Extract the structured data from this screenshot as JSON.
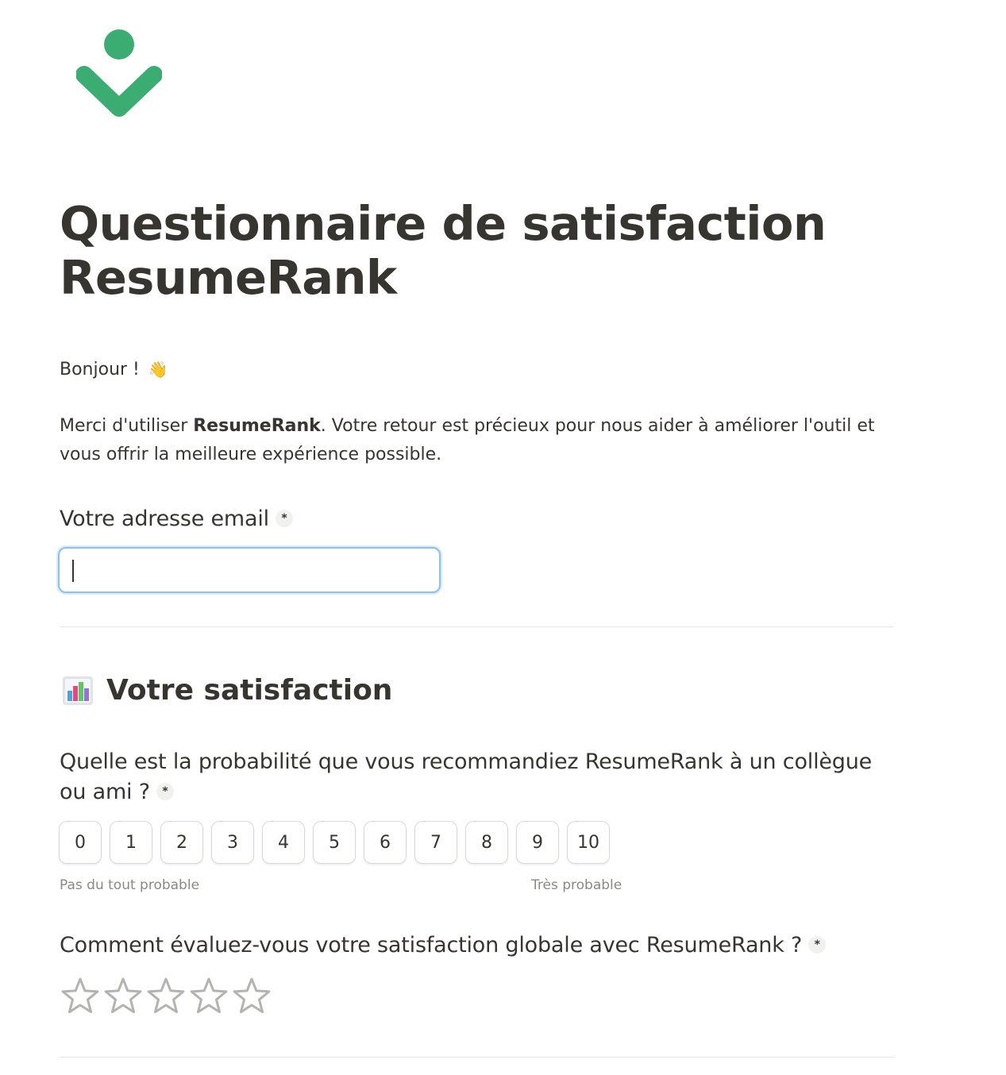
{
  "brand": {
    "logo_icon": "resumerank-checkmark-logo",
    "accent_color": "#3cad72"
  },
  "form": {
    "title": "Questionnaire de satisfaction ResumeRank",
    "greeting": "Bonjour !",
    "greeting_emoji": "👋",
    "intro_before": "Merci d'utiliser ",
    "intro_bold": "ResumeRank",
    "intro_after": ". Votre retour est précieux pour nous aider à améliorer l'outil et vous offrir la meilleure expérience possible."
  },
  "email_question": {
    "label": "Votre adresse email",
    "required_marker": "*",
    "value": "",
    "placeholder": ""
  },
  "section": {
    "icon": "bar-chart-icon",
    "title": "Votre satisfaction"
  },
  "nps_question": {
    "label": "Quelle est la probabilité que vous recommandiez ResumeRank à un collègue ou ami ?",
    "required_marker": "*",
    "options": [
      "0",
      "1",
      "2",
      "3",
      "4",
      "5",
      "6",
      "7",
      "8",
      "9",
      "10"
    ],
    "low_label": "Pas du tout probable",
    "high_label": "Très probable"
  },
  "rating_question": {
    "label": "Comment évaluez-vous votre satisfaction globale avec ResumeRank ?",
    "required_marker": "*",
    "max_stars": 5,
    "selected": 0
  }
}
